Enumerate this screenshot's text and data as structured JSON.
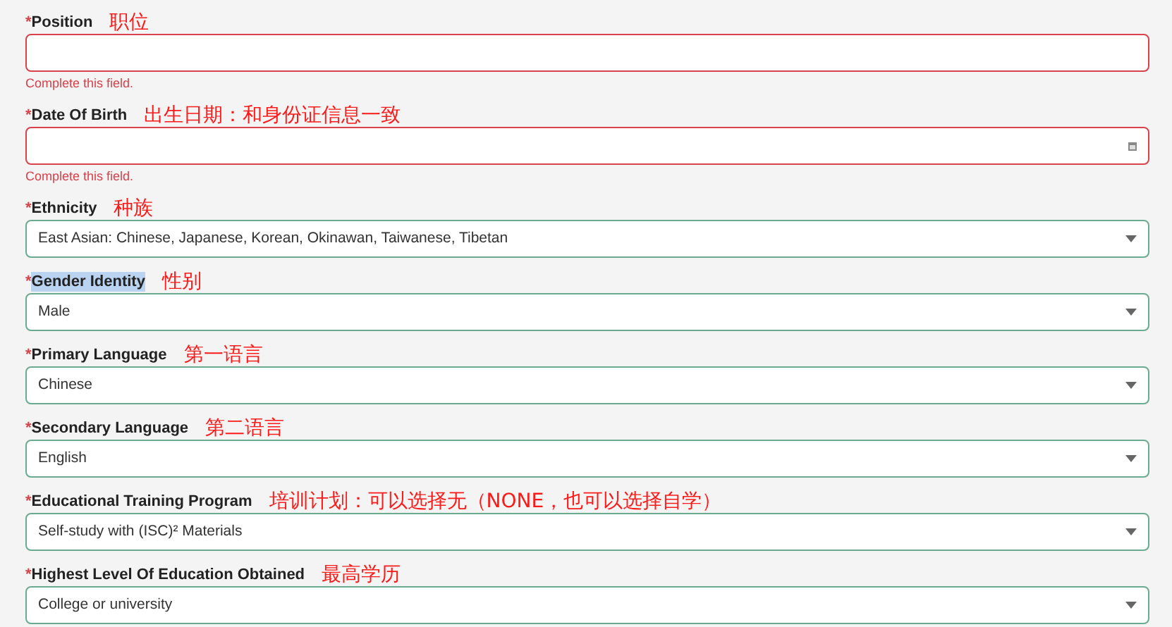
{
  "fields": [
    {
      "kind": "text",
      "required_mark": "*",
      "label": "Position",
      "annotation": "职位",
      "highlighted": false,
      "error": "Complete this field."
    },
    {
      "kind": "date",
      "required_mark": "*",
      "label": "Date Of Birth",
      "annotation": "出生日期：和身份证信息一致",
      "highlighted": false,
      "error": "Complete this field."
    },
    {
      "kind": "select",
      "required_mark": "*",
      "label": "Ethnicity",
      "annotation": "种族",
      "highlighted": false,
      "value": "East Asian: Chinese, Japanese, Korean, Okinawan, Taiwanese, Tibetan"
    },
    {
      "kind": "select",
      "required_mark": "*",
      "label": "Gender Identity",
      "annotation": "性别",
      "highlighted": true,
      "value": "Male"
    },
    {
      "kind": "select",
      "required_mark": "*",
      "label": "Primary Language",
      "annotation": "第一语言",
      "highlighted": false,
      "value": "Chinese"
    },
    {
      "kind": "select",
      "required_mark": "*",
      "label": "Secondary Language",
      "annotation": "第二语言",
      "highlighted": false,
      "value": "English"
    },
    {
      "kind": "select",
      "required_mark": "*",
      "label": "Educational Training Program",
      "annotation": "培训计划：可以选择无（NONE，也可以选择自学）",
      "highlighted": false,
      "value": "Self-study with (ISC)² Materials"
    },
    {
      "kind": "select",
      "required_mark": "*",
      "label": "Highest Level Of Education Obtained",
      "annotation": "最高学历",
      "highlighted": false,
      "value": "College or university"
    }
  ]
}
